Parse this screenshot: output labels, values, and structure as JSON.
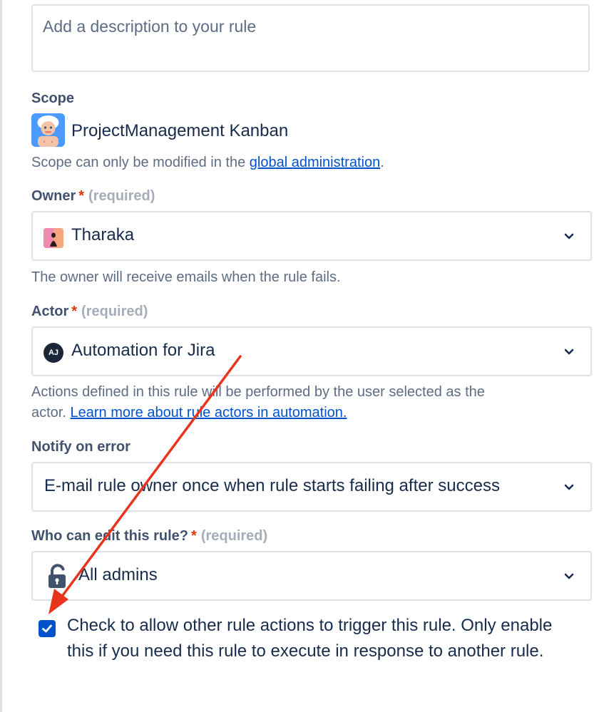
{
  "description": {
    "placeholder": "Add a description to your rule"
  },
  "scope": {
    "label": "Scope",
    "project_name": "ProjectManagement Kanban",
    "help_prefix": "Scope can only be modified in the ",
    "help_link": "global administration",
    "help_suffix": "."
  },
  "owner": {
    "label": "Owner",
    "required_star": "*",
    "required_text": "(required)",
    "value": "Tharaka",
    "help": "The owner will receive emails when the rule fails."
  },
  "actor": {
    "label": "Actor",
    "required_star": "*",
    "required_text": "(required)",
    "avatar_initials": "AJ",
    "value": "Automation for Jira",
    "help_line1": "Actions defined in this rule will be performed by the user selected as the",
    "help_line2_prefix": "actor. ",
    "help_link": "Learn more about rule actors in automation."
  },
  "notify": {
    "label": "Notify on error",
    "value": "E-mail rule owner once when rule starts failing after success"
  },
  "editors": {
    "label": "Who can edit this rule?",
    "required_star": "*",
    "required_text": "(required)",
    "value": "All admins",
    "icon": "unlock-icon"
  },
  "allow_trigger": {
    "checked": true,
    "text": "Check to allow other rule actions to trigger this rule. Only enable this if you need this rule to execute in response to another rule."
  },
  "annotation": {
    "arrow_color": "#e8341c"
  },
  "colors": {
    "link": "#0052cc",
    "checkbox": "#0052cc",
    "required": "#de350b"
  }
}
